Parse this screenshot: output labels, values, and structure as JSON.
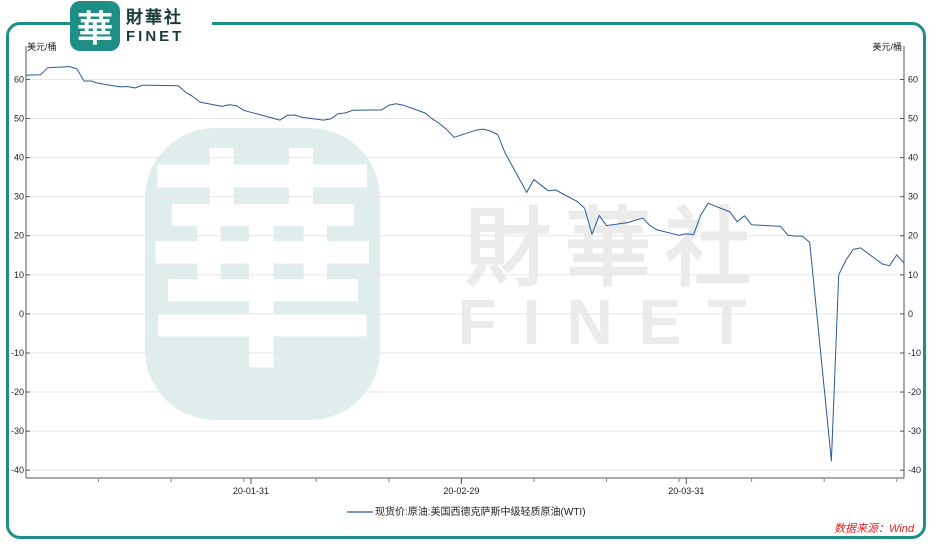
{
  "header": {
    "logo_cn": "財華社",
    "logo_en": "FINET",
    "seal_char": "華"
  },
  "watermark": {
    "cn": "財華社",
    "en": "FINET"
  },
  "source_text": "数据来源：Wind",
  "colors": {
    "frame": "#1f8f86",
    "series_line": "#2a5a9a",
    "source_text": "#e02020",
    "watermark": "#dfeeed"
  },
  "chart_data": {
    "type": "line",
    "unit_left": "美元/桶",
    "unit_right": "美元/桶",
    "ylim": [
      -42,
      66
    ],
    "y_ticks": [
      60,
      50,
      40,
      30,
      20,
      10,
      0,
      -10,
      -20,
      -30,
      -40
    ],
    "x_tick_labels": [
      {
        "label": "20-01-31",
        "date": "2020-01-31"
      },
      {
        "label": "20-02-29",
        "date": "2020-02-29"
      },
      {
        "label": "20-03-31",
        "date": "2020-03-31"
      }
    ],
    "xlim": [
      "2019-12-31",
      "2020-04-30"
    ],
    "grid": true,
    "legend_position": "bottom-center",
    "series": [
      {
        "name": "现货价:原油:美国西德克萨斯中级轻质原油(WTI)",
        "color": "#2a5a9a",
        "points": [
          [
            "2019-12-31",
            61.1
          ],
          [
            "2020-01-02",
            61.2
          ],
          [
            "2020-01-03",
            63.0
          ],
          [
            "2020-01-06",
            63.3
          ],
          [
            "2020-01-07",
            62.7
          ],
          [
            "2020-01-08",
            59.6
          ],
          [
            "2020-01-09",
            59.6
          ],
          [
            "2020-01-10",
            59.0
          ],
          [
            "2020-01-13",
            58.1
          ],
          [
            "2020-01-14",
            58.2
          ],
          [
            "2020-01-15",
            57.8
          ],
          [
            "2020-01-16",
            58.5
          ],
          [
            "2020-01-17",
            58.5
          ],
          [
            "2020-01-21",
            58.4
          ],
          [
            "2020-01-22",
            56.7
          ],
          [
            "2020-01-23",
            55.6
          ],
          [
            "2020-01-24",
            54.2
          ],
          [
            "2020-01-27",
            53.1
          ],
          [
            "2020-01-28",
            53.5
          ],
          [
            "2020-01-29",
            53.3
          ],
          [
            "2020-01-30",
            52.1
          ],
          [
            "2020-01-31",
            51.6
          ],
          [
            "2020-02-03",
            50.1
          ],
          [
            "2020-02-04",
            49.6
          ],
          [
            "2020-02-05",
            50.8
          ],
          [
            "2020-02-06",
            50.9
          ],
          [
            "2020-02-07",
            50.3
          ],
          [
            "2020-02-10",
            49.6
          ],
          [
            "2020-02-11",
            49.9
          ],
          [
            "2020-02-12",
            51.2
          ],
          [
            "2020-02-13",
            51.4
          ],
          [
            "2020-02-14",
            52.1
          ],
          [
            "2020-02-18",
            52.2
          ],
          [
            "2020-02-19",
            53.4
          ],
          [
            "2020-02-20",
            53.8
          ],
          [
            "2020-02-21",
            53.4
          ],
          [
            "2020-02-24",
            51.4
          ],
          [
            "2020-02-25",
            49.9
          ],
          [
            "2020-02-26",
            48.7
          ],
          [
            "2020-02-27",
            47.1
          ],
          [
            "2020-02-28",
            45.2
          ],
          [
            "2020-03-02",
            47.0
          ],
          [
            "2020-03-03",
            47.3
          ],
          [
            "2020-03-04",
            46.8
          ],
          [
            "2020-03-05",
            45.9
          ],
          [
            "2020-03-06",
            41.3
          ],
          [
            "2020-03-09",
            31.1
          ],
          [
            "2020-03-10",
            34.4
          ],
          [
            "2020-03-11",
            32.9
          ],
          [
            "2020-03-12",
            31.5
          ],
          [
            "2020-03-13",
            31.7
          ],
          [
            "2020-03-16",
            28.7
          ],
          [
            "2020-03-17",
            27.0
          ],
          [
            "2020-03-18",
            20.4
          ],
          [
            "2020-03-19",
            25.2
          ],
          [
            "2020-03-20",
            22.6
          ],
          [
            "2020-03-23",
            23.4
          ],
          [
            "2020-03-24",
            24.0
          ],
          [
            "2020-03-25",
            24.5
          ],
          [
            "2020-03-26",
            22.6
          ],
          [
            "2020-03-27",
            21.5
          ],
          [
            "2020-03-30",
            20.1
          ],
          [
            "2020-03-31",
            20.5
          ],
          [
            "2020-04-01",
            20.3
          ],
          [
            "2020-04-02",
            25.3
          ],
          [
            "2020-04-03",
            28.3
          ],
          [
            "2020-04-06",
            26.1
          ],
          [
            "2020-04-07",
            23.6
          ],
          [
            "2020-04-08",
            25.1
          ],
          [
            "2020-04-09",
            22.8
          ],
          [
            "2020-04-13",
            22.4
          ],
          [
            "2020-04-14",
            20.1
          ],
          [
            "2020-04-15",
            19.9
          ],
          [
            "2020-04-16",
            19.9
          ],
          [
            "2020-04-17",
            18.3
          ],
          [
            "2020-04-20",
            -37.6
          ],
          [
            "2020-04-21",
            10.0
          ],
          [
            "2020-04-22",
            13.8
          ],
          [
            "2020-04-23",
            16.5
          ],
          [
            "2020-04-24",
            16.9
          ],
          [
            "2020-04-27",
            12.8
          ],
          [
            "2020-04-28",
            12.3
          ],
          [
            "2020-04-29",
            15.1
          ],
          [
            "2020-04-30",
            13.0
          ]
        ]
      }
    ]
  }
}
